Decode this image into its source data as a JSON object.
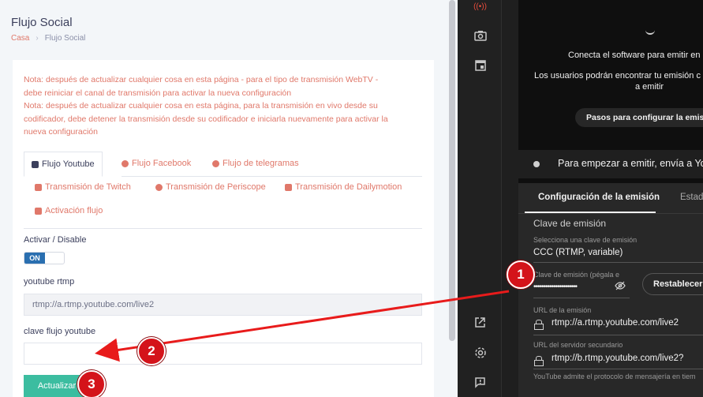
{
  "left": {
    "title": "Flujo Social",
    "breadcrumb": {
      "home": "Casa",
      "current": "Flujo Social"
    },
    "notes": [
      "Nota: después de actualizar cualquier cosa en esta página - para el tipo de transmisión WebTV -",
      "debe reiniciar el canal de transmisión para activar la nueva configuración",
      "Nota: después de actualizar cualquier cosa en esta página, para la transmisión en vivo desde su",
      "codificador, debe detener la transmisión desde su codificador e iniciarla nuevamente para activar la",
      "nueva configuración"
    ],
    "tabs": [
      {
        "label": "Flujo Youtube",
        "icon": "youtube-icon"
      },
      {
        "label": "Flujo Facebook",
        "icon": "facebook-icon"
      },
      {
        "label": "Flujo de telegramas",
        "icon": "telegram-icon"
      },
      {
        "label": "Transmisión de Twitch",
        "icon": "twitch-icon"
      },
      {
        "label": "Transmisión de Periscope",
        "icon": "periscope-icon"
      },
      {
        "label": "Transmisión de Dailymotion",
        "icon": "dailymotion-icon"
      },
      {
        "label": "Activación flujo",
        "icon": "check-icon"
      }
    ],
    "toggle_label": "Activar / Disable",
    "toggle_value": "ON",
    "rtmp_label": "youtube rtmp",
    "rtmp_value": "rtmp://a.rtmp.youtube.com/live2",
    "key_label": "clave flujo youtube",
    "key_value": "",
    "save_button": "Actualizar"
  },
  "right": {
    "preview_lines": [
      "Conecta el software para emitir en",
      "Los usuarios podrán encontrar tu emisión c",
      "a emitir"
    ],
    "setup_button": "Pasos para configurar la emis",
    "status_text": "Para empezar a emitir, envía a Yo",
    "tabs": [
      "Configuración de la emisión",
      "Estad"
    ],
    "section_title": "Clave de emisión",
    "select_key_label": "Selecciona una clave de emisión",
    "select_key_value": "CCC (RTMP, variable)",
    "key_field_label": "Clave de emisión (pégala e",
    "key_field_value": "••••••••••••••••••••••",
    "reset_button": "Restablecer",
    "url_label": "URL de la emisión",
    "url_value": "rtmp://a.rtmp.youtube.com/live2",
    "backup_label": "URL del servidor secundario",
    "backup_value": "rtmp://b.rtmp.youtube.com/live2?",
    "footer_text": "YouTube admite el protocolo de mensajería en tiem"
  },
  "annotations": [
    "1",
    "2",
    "3"
  ],
  "colors": {
    "accent": "#e0786a",
    "save": "#3cbda0",
    "toggle": "#2a6fb0",
    "marker": "#d4131a"
  }
}
